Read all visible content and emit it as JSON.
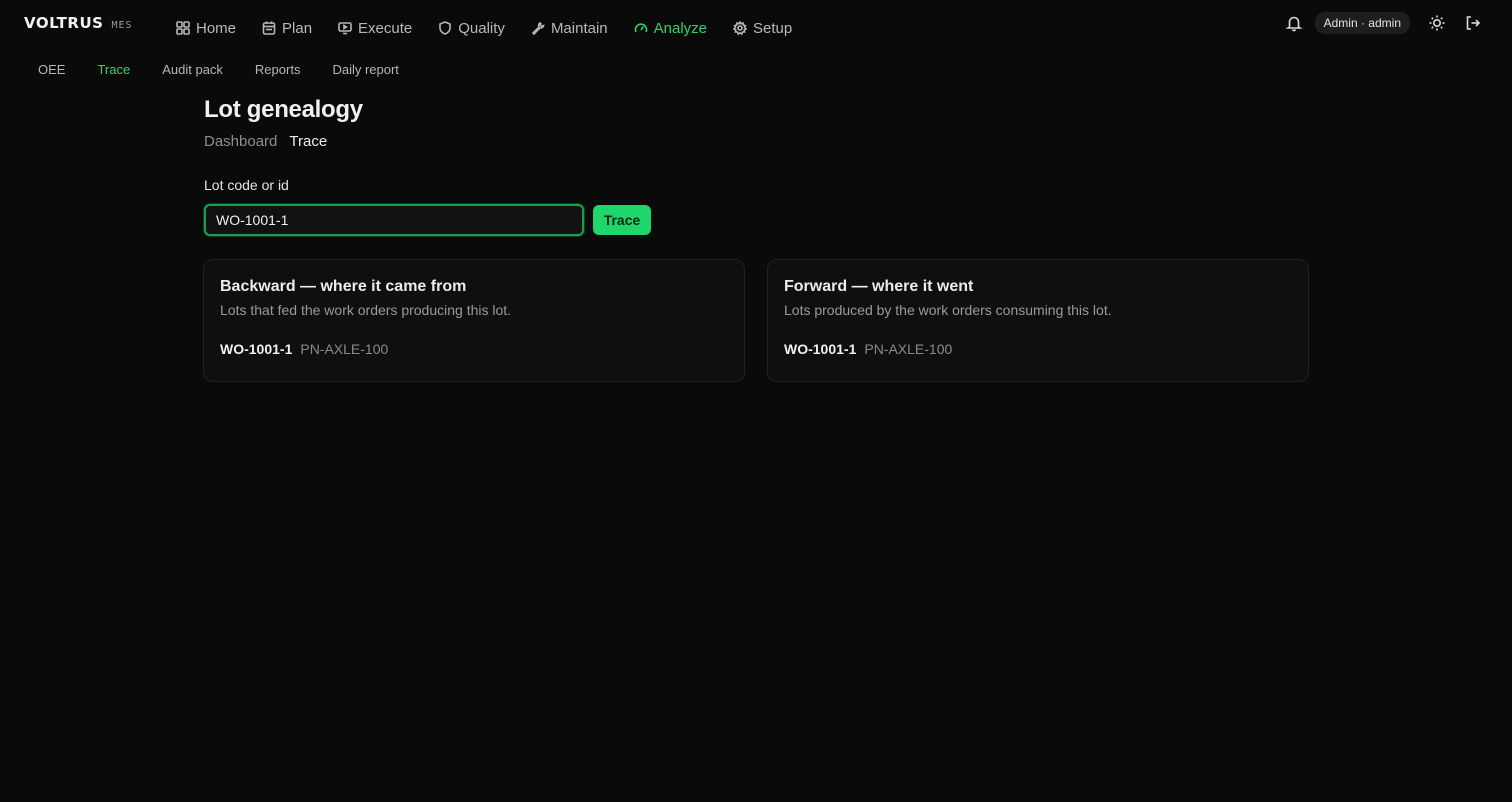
{
  "brand": {
    "name": "VOLTRUS",
    "sub": "MES"
  },
  "nav": {
    "items": [
      {
        "label": "Home",
        "icon": "grid-icon",
        "active": false
      },
      {
        "label": "Plan",
        "icon": "calendar-icon",
        "active": false
      },
      {
        "label": "Execute",
        "icon": "monitor-icon",
        "active": false
      },
      {
        "label": "Quality",
        "icon": "shield-icon",
        "active": false
      },
      {
        "label": "Maintain",
        "icon": "wrench-icon",
        "active": false
      },
      {
        "label": "Analyze",
        "icon": "gauge-icon",
        "active": true
      },
      {
        "label": "Setup",
        "icon": "gear-icon",
        "active": false
      }
    ]
  },
  "header": {
    "user": "Admin · admin"
  },
  "subnav": {
    "items": [
      {
        "label": "OEE",
        "active": false
      },
      {
        "label": "Trace",
        "active": true
      },
      {
        "label": "Audit pack",
        "active": false
      },
      {
        "label": "Reports",
        "active": false
      },
      {
        "label": "Daily report",
        "active": false
      }
    ]
  },
  "page": {
    "title": "Lot genealogy",
    "breadcrumb": [
      "Dashboard",
      "Trace"
    ]
  },
  "form": {
    "label": "Lot code or id",
    "value": "WO-1001-1",
    "button": "Trace"
  },
  "cards": [
    {
      "title": "Backward — where it came from",
      "description": "Lots that fed the work orders producing this lot.",
      "lots": [
        {
          "code": "WO-1001-1",
          "part": "PN-AXLE-100"
        }
      ]
    },
    {
      "title": "Forward — where it went",
      "description": "Lots produced by the work orders consuming this lot.",
      "lots": [
        {
          "code": "WO-1001-1",
          "part": "PN-AXLE-100"
        }
      ]
    }
  ],
  "colors": {
    "accent": "#2fd36b",
    "button": "#1ed66c",
    "background": "#0a0a0a"
  }
}
